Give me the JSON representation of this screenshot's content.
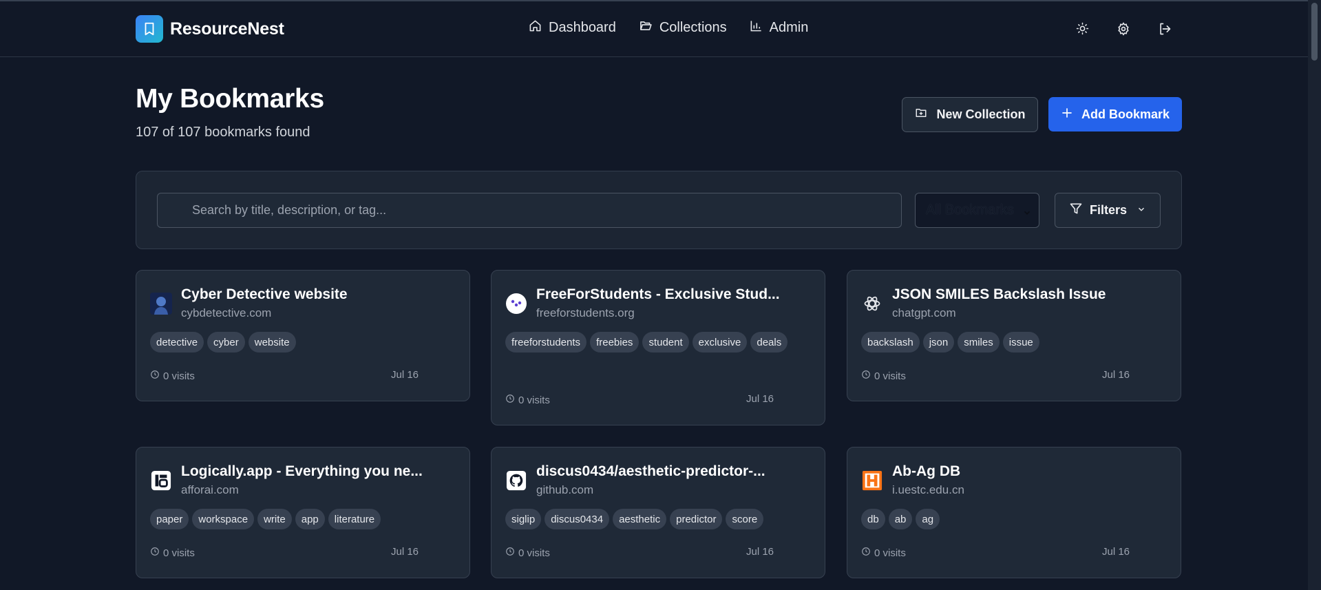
{
  "app": {
    "name": "ResourceNest"
  },
  "nav": [
    {
      "label": "Dashboard",
      "icon": "home-icon"
    },
    {
      "label": "Collections",
      "icon": "folder-open-icon"
    },
    {
      "label": "Admin",
      "icon": "bar-chart-icon"
    }
  ],
  "header_actions": [
    "sun-icon",
    "gear-icon",
    "logout-icon"
  ],
  "page": {
    "title": "My Bookmarks",
    "subtitle": "107 of 107 bookmarks found",
    "new_collection_label": "New Collection",
    "add_bookmark_label": "Add Bookmark"
  },
  "filters": {
    "search_placeholder": "Search by title, description, or tag...",
    "select_value": "All Bookmarks",
    "filters_label": "Filters"
  },
  "colors": {
    "background": "#111827",
    "card": "#1f2937",
    "accent": "#2563eb",
    "tag": "#374151"
  },
  "bookmarks": [
    {
      "title": "Cyber Detective website",
      "domain": "cybdetective.com",
      "icon": "detective-avatar-icon",
      "tags": [
        "detective",
        "cyber",
        "website"
      ],
      "visits": "0 visits",
      "date": "Jul 16"
    },
    {
      "title": "FreeForStudents - Exclusive Stud...",
      "domain": "freeforstudents.org",
      "icon": "freeforstudents-logo-icon",
      "tags": [
        "freeforstudents",
        "freebies",
        "student",
        "exclusive",
        "deals"
      ],
      "visits": "0 visits",
      "date": "Jul 16"
    },
    {
      "title": "JSON SMILES Backslash Issue",
      "domain": "chatgpt.com",
      "icon": "openai-logo-icon",
      "tags": [
        "backslash",
        "json",
        "smiles",
        "issue"
      ],
      "visits": "0 visits",
      "date": "Jul 16"
    },
    {
      "title": "Logically.app - Everything you ne...",
      "domain": "afforai.com",
      "icon": "logically-logo-icon",
      "tags": [
        "paper",
        "workspace",
        "write",
        "app",
        "literature"
      ],
      "visits": "0 visits",
      "date": "Jul 16"
    },
    {
      "title": "discus0434/aesthetic-predictor-...",
      "domain": "github.com",
      "icon": "github-logo-icon",
      "tags": [
        "siglip",
        "discus0434",
        "aesthetic",
        "predictor",
        "score"
      ],
      "visits": "0 visits",
      "date": "Jul 16"
    },
    {
      "title": "Ab-Ag DB",
      "domain": "i.uestc.edu.cn",
      "icon": "h-logo-icon",
      "tags": [
        "db",
        "ab",
        "ag"
      ],
      "visits": "0 visits",
      "date": "Jul 16"
    }
  ]
}
